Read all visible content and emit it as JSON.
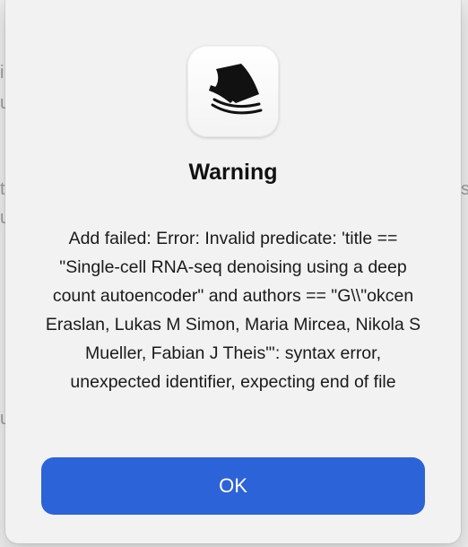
{
  "dialog": {
    "title": "Warning",
    "message": "Add failed: Error: Invalid predicate: 'title == \"Single-cell RNA-seq denoising using a deep count autoencoder\" and authors == \"G\\\\\"okcen Eraslan, Lukas M Simon, Maria Mircea, Nikola S Mueller, Fabian J Theis\"': syntax error, unexpected identifier, expecting end of file",
    "ok_label": "OK",
    "icon": "papers-stack-icon"
  },
  "colors": {
    "accent": "#2d63d8",
    "dialog_background": "#f2f2f2"
  }
}
